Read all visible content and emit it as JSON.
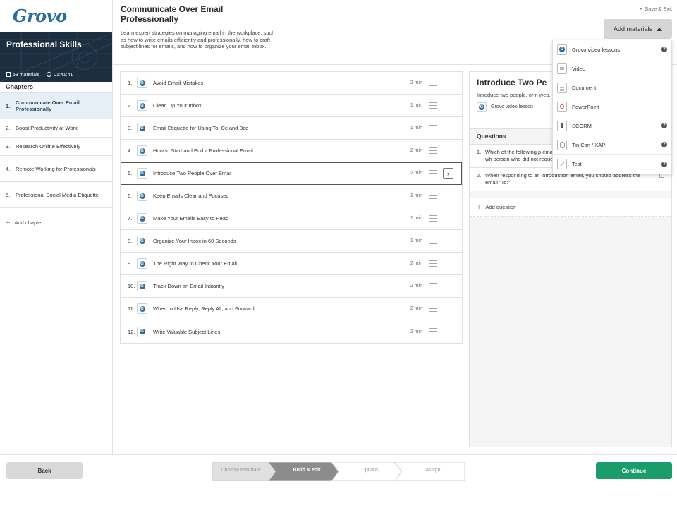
{
  "brand": {
    "logo": "Grovo"
  },
  "course": {
    "title": "Professional Skills",
    "materials": "53 materials",
    "duration": "01:41:41"
  },
  "sidebar": {
    "chapters_heading": "Chapters",
    "chapters": [
      {
        "num": "1.",
        "label": "Communicate Over Email Professionally"
      },
      {
        "num": "2.",
        "label": "Boost Productivity at Work"
      },
      {
        "num": "3.",
        "label": "Research Online Effectively"
      },
      {
        "num": "4.",
        "label": "Remote Working for Professionals"
      },
      {
        "num": "5.",
        "label": "Professional Social Media Etiquette"
      }
    ],
    "add_chapter": "Add chapter"
  },
  "header": {
    "title": "Communicate Over Email Professionally",
    "description": "Learn expert strategies on managing email in the workplace, such as how to write emails efficiently and professionally, how to craft subject lines for emails, and how to organize your email inbox.",
    "save_exit": "Save & Exit",
    "add_materials": "Add materials"
  },
  "lessons": [
    {
      "num": "1.",
      "title": "Avoid Email Mistakes",
      "duration": "2 min"
    },
    {
      "num": "2.",
      "title": "Clean Up Your Inbox",
      "duration": "1 min"
    },
    {
      "num": "3.",
      "title": "Email Etiquette for Using To, Cc and Bcc",
      "duration": "1 min"
    },
    {
      "num": "4.",
      "title": "How to Start and End a Professional Email",
      "duration": "2 min"
    },
    {
      "num": "5.",
      "title": "Introduce Two People Over Email",
      "duration": "2 min"
    },
    {
      "num": "6.",
      "title": "Keep Emails Clear and Focused",
      "duration": "1 min"
    },
    {
      "num": "7.",
      "title": "Make Your Emails Easy to Read",
      "duration": "1 min"
    },
    {
      "num": "8.",
      "title": "Organize Your Inbox in 60 Seconds",
      "duration": "1 min"
    },
    {
      "num": "9.",
      "title": "The Right Way to Check Your Email",
      "duration": "2 min"
    },
    {
      "num": "10.",
      "title": "Track Down an Email Instantly",
      "duration": "2 min"
    },
    {
      "num": "11.",
      "title": "When to Use Reply, Reply All, and Forward",
      "duration": "2 min"
    },
    {
      "num": "12.",
      "title": "Write Valuable Subject Lines",
      "duration": "2 min"
    }
  ],
  "detail": {
    "title": "Introduce Two Pe",
    "description": "Introduce two people, or n web.",
    "type": "Grovo video lesson",
    "questions_heading": "Questions",
    "questions": [
      {
        "num": "1.",
        "text": "Which of the following p email introduction? I. The parties II. The person wh person who did not request the introduction"
      },
      {
        "num": "2.",
        "text": "When responding to an introduction email, you should address the email \"To:\""
      }
    ],
    "add_question": "Add question"
  },
  "dropdown": [
    {
      "label": "Grovo video lessons",
      "icon": "grovo-icon",
      "help": true
    },
    {
      "label": "Video",
      "icon": "video-icon",
      "help": false
    },
    {
      "label": "Document",
      "icon": "document-icon",
      "help": false
    },
    {
      "label": "PowerPoint",
      "icon": "powerpoint-icon",
      "help": false
    },
    {
      "label": "SCORM",
      "icon": "scorm-icon",
      "help": true
    },
    {
      "label": "Tin Can / XAPI",
      "icon": "tincan-icon",
      "help": true
    },
    {
      "label": "Test",
      "icon": "test-icon",
      "help": true
    }
  ],
  "footer": {
    "back": "Back",
    "continue": "Continue",
    "steps": [
      "Choose template",
      "Build & edit",
      "Options",
      "Assign"
    ],
    "active_step": 1
  },
  "colors": {
    "brand": "#2a6d9c",
    "continue": "#1a9c6b",
    "active_step": "#8c8c8c"
  }
}
